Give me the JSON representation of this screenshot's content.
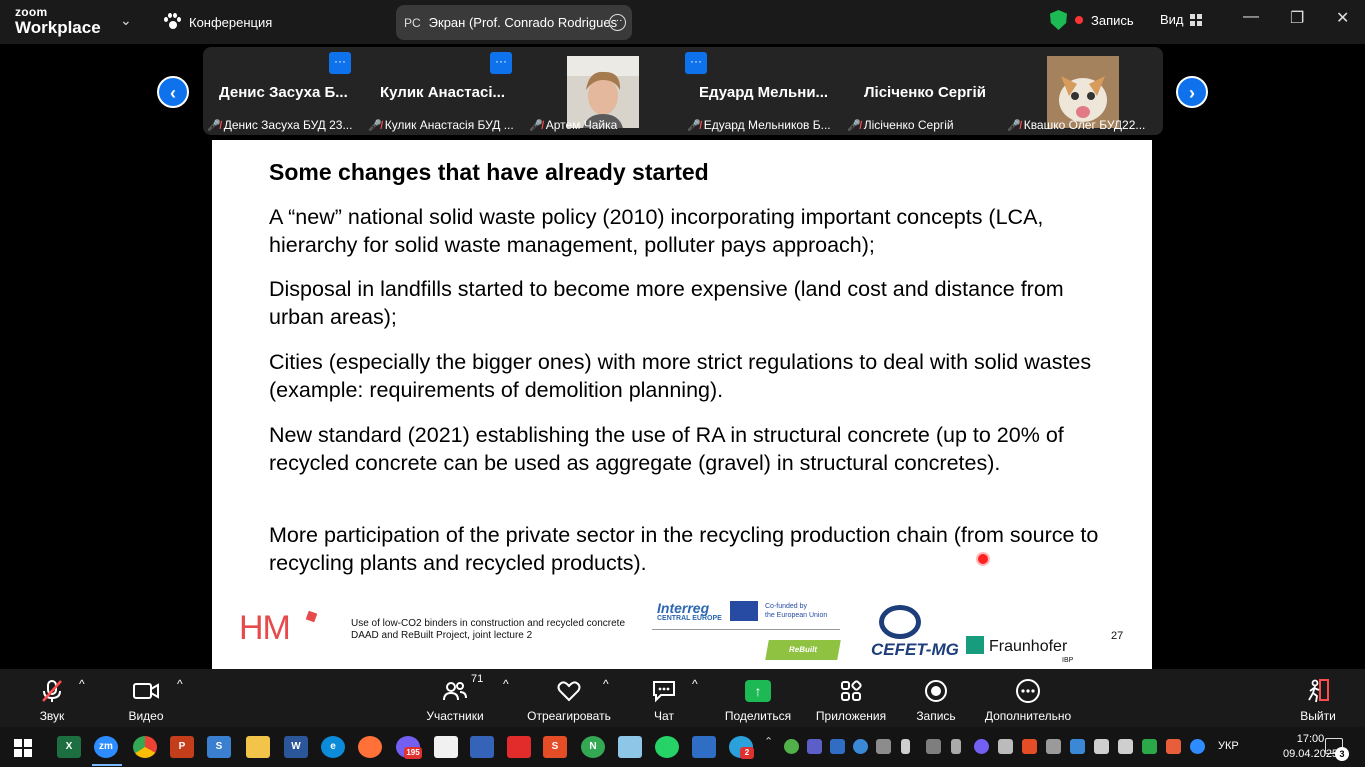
{
  "titlebar": {
    "app_line1": "zoom",
    "app_line2": "Workplace",
    "meeting_label": "Конференция",
    "share_initials": "PC",
    "share_title": "Экран (Prof. Conrado Rodrigues",
    "record_label": "Запись",
    "view_label": "Вид"
  },
  "participants": [
    {
      "big_name": "Денис Засуха Б...",
      "caption": "Денис Засуха БУД 23..."
    },
    {
      "big_name": "Кулик Анастасі...",
      "caption": "Кулик Анастасія БУД ..."
    },
    {
      "big_name": "",
      "caption": "Артем Чайка"
    },
    {
      "big_name": "Едуард Мельни...",
      "caption": "Едуард Мельников Б..."
    },
    {
      "big_name": "Лісіченко Сергій",
      "caption": "Лісіченко Сергій"
    },
    {
      "big_name": "",
      "caption": "Квашко Олег БУД22..."
    }
  ],
  "slide": {
    "title": "Some changes that have already started",
    "bullets": [
      "A “new” national solid waste policy (2010) incorporating important concepts (LCA, hierarchy for solid waste management, polluter pays approach);",
      "Disposal in landfills started to become more expensive (land cost and distance from urban areas);",
      "Cities (especially the bigger ones) with more strict regulations to deal with solid wastes (example: requirements of demolition planning).",
      "New standard (2021) establishing the use of RA in structural concrete (up to 20% of recycled concrete can be used as aggregate (gravel) in structural concretes).",
      "More participation of the private sector in the recycling production chain (from source to recycling plants and recycled products)."
    ],
    "footer_logo": "HM",
    "footer_line1": "Use of low-CO2 binders in construction and recycled concrete",
    "footer_line2": "DAAD and ReBuilt Project, joint lecture 2",
    "interreg": "Interreg",
    "interreg_sub": "CENTRAL EUROPE",
    "cofunded_1": "Co-funded by",
    "cofunded_2": "the European Union",
    "rebuilt": "ReBuilt",
    "cefet": "CEFET-MG",
    "fraunhofer": "Fraunhofer",
    "fraunhofer_sub": "IBP",
    "page_number": "27"
  },
  "toolbar": {
    "audio": "Звук",
    "video": "Видео",
    "participants": "Участники",
    "participants_count": "71",
    "react": "Отреагировать",
    "chat": "Чат",
    "share": "Поделиться",
    "apps": "Приложения",
    "record": "Запись",
    "more": "Дополнительно",
    "leave": "Выйти"
  },
  "taskbar": {
    "viber_badge": "195",
    "telegram_badge": "2",
    "language": "УКР",
    "time": "17:00",
    "date": "09.04.2025",
    "notifications": "3"
  },
  "colors": {
    "zoom_blue": "#0e72ed",
    "share_green": "#1db954",
    "hm_red": "#e64a4a",
    "mic_off_red": "#ff4d4d"
  }
}
